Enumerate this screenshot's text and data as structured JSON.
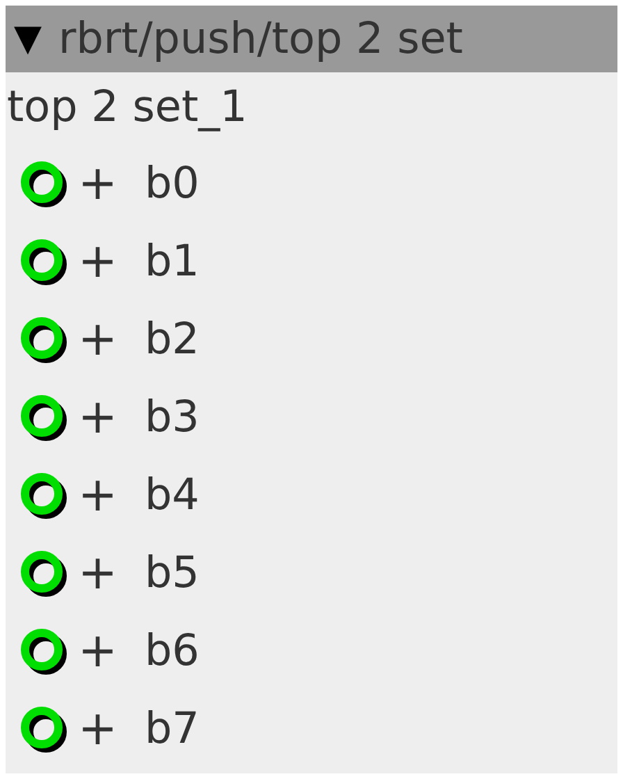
{
  "header": {
    "toggle": "▼",
    "title": "rbrt/push/top 2 set"
  },
  "subtitle": "top 2 set_1",
  "items": [
    {
      "expand": "+",
      "label": "b0"
    },
    {
      "expand": "+",
      "label": "b1"
    },
    {
      "expand": "+",
      "label": "b2"
    },
    {
      "expand": "+",
      "label": "b3"
    },
    {
      "expand": "+",
      "label": "b4"
    },
    {
      "expand": "+",
      "label": "b5"
    },
    {
      "expand": "+",
      "label": "b6"
    },
    {
      "expand": "+",
      "label": "b7"
    }
  ]
}
